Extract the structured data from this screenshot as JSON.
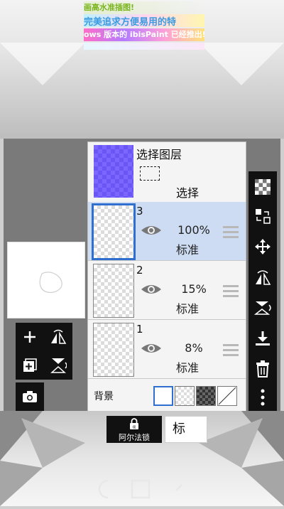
{
  "promo_banner": {
    "line1": "画高水准插图!",
    "line2": "完美追求方便易用的特",
    "line3": "ows 版本的 ibisPaint 已经推出!"
  },
  "layer_panel": {
    "selection_layer": {
      "title": "选择图层",
      "label": "选择"
    },
    "layers": [
      {
        "number": "3",
        "opacity": "100%",
        "blend_mode": "标准",
        "selected": true
      },
      {
        "number": "2",
        "opacity": "15%",
        "blend_mode": "标准",
        "selected": false
      },
      {
        "number": "1",
        "opacity": "8%",
        "blend_mode": "标准",
        "selected": false
      }
    ],
    "background": {
      "label": "背景",
      "swatches": [
        "white",
        "transparent",
        "dark-checker",
        "none"
      ]
    }
  },
  "bottom_bar": {
    "alpha_lock_label": "阿尔法锁",
    "blend_tab_label": "标"
  },
  "colors": {
    "selection_blue": "#2e6fcf",
    "active_row": "#cddcf2",
    "toolbar_bg": "#111111",
    "selection_layer_purple": "#7b66ff"
  },
  "icons": {
    "left_tools": [
      "add-layer-icon",
      "flip-horizontal-icon",
      "add-copy-layer-icon",
      "flip-vertical-icon",
      "camera-icon"
    ],
    "right_tools": [
      "checker-icon",
      "move-layer-icon",
      "transform-move-icon",
      "rotate-flip-icon",
      "flip-rotate-icon",
      "merge-down-icon",
      "trash-icon",
      "more-icon"
    ],
    "nav": [
      "back-icon",
      "home-icon",
      "recent-icon"
    ]
  }
}
